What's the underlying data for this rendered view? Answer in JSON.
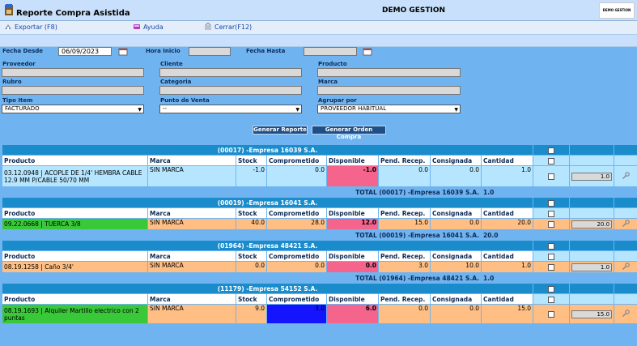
{
  "window": {
    "title": "Reporte Compra Asistida",
    "company": "DEMO GESTION",
    "logo_text": "DEMO GESTION"
  },
  "menu": [
    {
      "label": "Exportar (F8)",
      "icon": "export-icon"
    },
    {
      "label": "Ayuda",
      "icon": "help-icon"
    },
    {
      "label": "Cerrar(F12)",
      "icon": "close-icon"
    }
  ],
  "filters": {
    "fecha_desde_label": "Fecha Desde",
    "fecha_desde_value": "06/09/2023",
    "hora_inicio_label": "Hora Inicio",
    "hora_inicio_value": "",
    "fecha_hasta_label": "Fecha Hasta",
    "fecha_hasta_value": "",
    "proveedor_label": "Proveedor",
    "cliente_label": "Cliente",
    "producto_label": "Producto",
    "rubro_label": "Rubro",
    "categoria_label": "Categoria",
    "marca_label": "Marca",
    "tipo_item_label": "Tipo Item",
    "tipo_item_value": "FACTURADO",
    "punto_venta_label": "Punto de Venta",
    "punto_venta_value": "--",
    "agrupar_label": "Agrupar por",
    "agrupar_value": "PROVEEDOR HABITUAL"
  },
  "buttons": {
    "generar_reporte": "Generar Reporte",
    "generar_orden": "Generar Orden Compra"
  },
  "columns": [
    "Producto",
    "Marca",
    "Stock",
    "Comprometido",
    "Disponible",
    "Pend. Recep.",
    "Consignada",
    "Cantidad"
  ],
  "groups": [
    {
      "title": "(00017) -Empresa 16039 S.A.",
      "rows": [
        {
          "producto": "03.12.0948 | ACOPLE DE 1/4' HEMBRA CABLE 12.9 MM P/CABLE 50/70 MM",
          "marca": "SIN MARCA",
          "stock": "-1.0",
          "comprometido": "0.0",
          "disponible": "-1.0",
          "pend": "0.0",
          "consignada": "0.0",
          "cantidad": "1.0",
          "qty_input": "1.0"
        }
      ],
      "total_label": "TOTAL (00017) -Empresa 16039 S.A.",
      "total_value": "1.0"
    },
    {
      "title": "(00019) -Empresa 16041 S.A.",
      "rows": [
        {
          "producto": "09.22.0668 | TUERCA 3/8",
          "marca": "SIN MARCA",
          "stock": "40.0",
          "comprometido": "28.0",
          "disponible": "12.0",
          "pend": "15.0",
          "consignada": "0.0",
          "cantidad": "20.0",
          "qty_input": "20.0"
        }
      ],
      "total_label": "TOTAL (00019) -Empresa 16041 S.A.",
      "total_value": "20.0"
    },
    {
      "title": "(01964) -Empresa 48421 S.A.",
      "rows": [
        {
          "producto": "08.19.1258 | Caño 3/4'",
          "marca": "SIN MARCA",
          "stock": "0.0",
          "comprometido": "0.0",
          "disponible": "0.0",
          "pend": "3.0",
          "consignada": "10.0",
          "cantidad": "1.0",
          "qty_input": "1.0"
        }
      ],
      "total_label": "TOTAL (01964) -Empresa 48421 S.A.",
      "total_value": "1.0"
    },
    {
      "title": "(11179) -Empresa 54152 S.A.",
      "rows": [
        {
          "producto": "08.19.1693 | Alquiler Martillo electrico con 2 puntas",
          "marca": "SIN MARCA",
          "stock": "9.0",
          "comprometido": "3.0",
          "disponible": "6.0",
          "pend": "0.0",
          "consignada": "0.0",
          "cantidad": "15.0",
          "qty_input": "15.0"
        }
      ],
      "total_label": "",
      "total_value": ""
    }
  ],
  "colors": {
    "pink": "#f4648c",
    "green": "#38c838",
    "orange": "#ffbf84",
    "lightblue": "#b6e6ff",
    "blue": "#1414ff"
  }
}
